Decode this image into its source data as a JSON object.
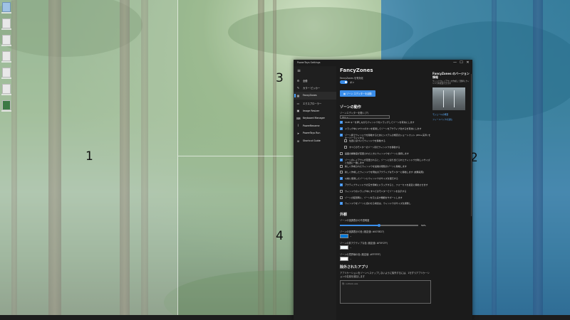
{
  "desktop": {
    "icons": [
      "recycle-bin-icon",
      "file-icon",
      "file-icon",
      "file-icon",
      "file-icon",
      "file-icon",
      "image-file-icon"
    ],
    "zones": [
      "1",
      "2",
      "3",
      "4"
    ],
    "zone_highlight_color": "#1e6fd2"
  },
  "window": {
    "title": "PowerToys Settings",
    "controls": [
      "—",
      "☐",
      "✕"
    ]
  },
  "sidebar": {
    "menu_icon": "≡",
    "items": [
      {
        "label": "全般",
        "icon": "gear-icon"
      },
      {
        "label": "カラー ピッカー",
        "icon": "color-picker-icon"
      },
      {
        "label": "FancyZones",
        "icon": "fancyzones-icon"
      },
      {
        "label": "エクスプローラー",
        "icon": "folder-icon"
      },
      {
        "label": "Image Resizer",
        "icon": "image-resizer-icon"
      },
      {
        "label": "Keyboard Manager",
        "icon": "keyboard-icon"
      },
      {
        "label": "PowerRename",
        "icon": "rename-icon"
      },
      {
        "label": "PowerToys Run",
        "icon": "run-icon"
      },
      {
        "label": "Shortcut Guide",
        "icon": "shortcut-icon"
      }
    ]
  },
  "main": {
    "title": "FancyZones",
    "enable_label": "FancyZones を有効化",
    "enable_state": "オン",
    "launch_editor": "ゾーン エディターを起動",
    "zone_behavior_heading": "ゾーンの動作",
    "hotkey_label": "ゾーンエディターを開く(ア)",
    "hotkey_value": "Win + `",
    "checkboxes": [
      {
        "label": "Shift キーを押しながらウィンドウをドラッグしてゾーンを有効にします",
        "checked": true,
        "indent": false
      },
      {
        "label": "ドラッグ中にマウスボタンを使用してゾーンをアクティブ化するを有効にします",
        "checked": true,
        "indent": false
      },
      {
        "label": "ゾーン間でウィンドウを移動するためにシステムの規定のショートカット (Win+矢印) をオーバーライドする",
        "checked": true,
        "indent": false
      },
      {
        "label": "位置に基づいてウィンドウを移動する",
        "checked": false,
        "indent": true
      },
      {
        "label": "すべてのモニターのゾーン間でウィンドウを移動する",
        "checked": false,
        "indent": true
      },
      {
        "label": "画面の解像度が変更されたときにウィンドウをゾーンに保持します",
        "checked": false,
        "indent": false
      },
      {
        "label": "ゾーンのレイアウトが変更されると、ゾーンに割り当てられたウィンドウが新しいサイズと位置に一致します",
        "checked": true,
        "indent": false
      },
      {
        "label": "新しく作成されたウィンドウを最後の既知のゾーンに移動します",
        "checked": false,
        "indent": false
      },
      {
        "label": "新しく作成したウィンドウを現在のアクティブなモニターに移動します (試験段階)",
        "checked": false,
        "indent": false
      },
      {
        "label": "以前に使用したゾーンにウィンドウのサイズを復元する",
        "checked": true,
        "indent": false
      },
      {
        "label": "アクティブウィンドウの空き領域にドラッグすると、フォーカスを最近に移動させます",
        "checked": true,
        "indent": false
      },
      {
        "label": "ウィンドウのドラッグ中にすべてのモニターでゾーンを表示する",
        "checked": false,
        "indent": false
      },
      {
        "label": "ゾーンの配置時に、ゾーンを元に戻す機能をサポートします",
        "checked": false,
        "indent": false
      },
      {
        "label": "ウィンドウをゾーンに合わせる場合は、ウィンドウのサイズを調整し",
        "checked": true,
        "indent": false
      }
    ],
    "appearance_heading": "外観",
    "opacity_label": "ゾーンの強調表示の不透明度",
    "opacity_value": "50%",
    "opacity_fraction": 0.5,
    "color_pickers": [
      {
        "label": "ゾーンの強調表示の色 (既定値: #0078D7)",
        "color": "#0078d7"
      },
      {
        "label": "ゾーンの非アクティブな色 (既定値: #F5FCFF)",
        "color": "#f5fcff"
      },
      {
        "label": "ゾーンの境界線の色 (既定値: #FFFFFF)",
        "color": "#ffffff"
      }
    ],
    "excluded_heading": "除外されたアプリ",
    "excluded_desc": "アプリケーションをゾーンへスナップしないように除外するには、1行ずつアプリケーションの名前を追加します",
    "excluded_placeholder": "例: outlook.exe"
  },
  "about": {
    "title": "FancyZones のバージョン情報",
    "text": "ウィンドウレイアウトを作成して簡単にウィンドウを配置できます",
    "links": [
      "モジュールの概要",
      "フィードバックの送信"
    ]
  }
}
